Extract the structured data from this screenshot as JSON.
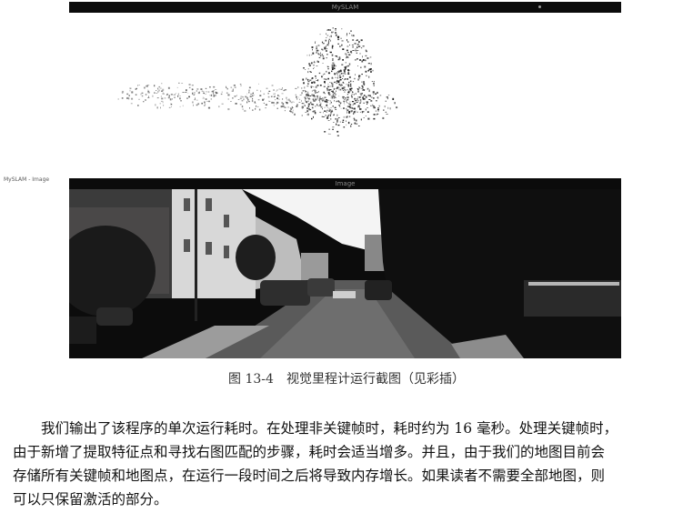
{
  "figure": {
    "map_window": {
      "title": "MySLAM"
    },
    "image_window": {
      "title": "Image",
      "bottom_label": "MySLAM - Image"
    }
  },
  "caption": "图 13-4　视觉里程计运行截图（见彩插）",
  "paragraph": {
    "lines": [
      "　　我们输出了该程序的单次运行耗时。在处理非关键帧时，耗时约为 16 毫秒。处理关键帧时，",
      "由于新增了提取特征点和寻找右图匹配的步骤，耗时会适当增多。并且，由于我们的地图目前会",
      "存储所有关键帧和地图点，在运行一段时间之后将导致内存增长。如果读者不需要全部地图，则",
      "可以只保留激活的部分。"
    ]
  }
}
